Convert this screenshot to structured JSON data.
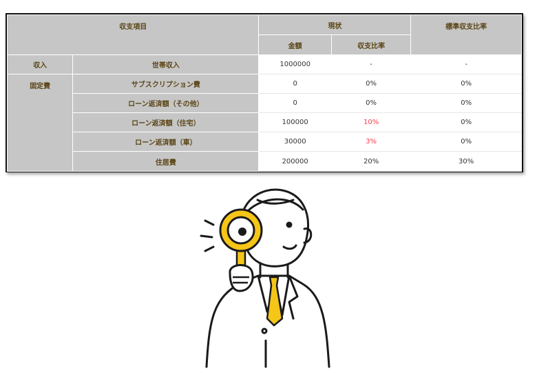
{
  "table": {
    "header": {
      "item": "収支項目",
      "current": "現状",
      "standard": "標準収支比率",
      "amount": "金額",
      "ratio": "収支比率"
    },
    "rows": [
      {
        "category": "収入",
        "label": "世帯収入",
        "amount": "1000000",
        "ratio": "-",
        "standard": "-"
      },
      {
        "category": "固定費",
        "label": "サブスクリプション費",
        "amount": "0",
        "ratio": "0%",
        "standard": "0%"
      },
      {
        "category": "",
        "label": "ローン返済額（その他）",
        "amount": "0",
        "ratio": "0%",
        "standard": "0%"
      },
      {
        "category": "",
        "label": "ローン返済額（住宅）",
        "amount": "100000",
        "ratio": "10%",
        "standard": "0%"
      },
      {
        "category": "",
        "label": "ローン返済額（車）",
        "amount": "30000",
        "ratio": "3%",
        "standard": "0%"
      },
      {
        "category": "",
        "label": "住居費",
        "amount": "200000",
        "ratio": "20%",
        "standard": "30%"
      }
    ],
    "colors": {
      "header_bg": "#c6c6c6",
      "header_text": "#5b4516",
      "highlight": "#ff3b4a"
    }
  },
  "illustration": {
    "icon": "businessman-magnifying-glass-icon",
    "accent": "#f5c518"
  }
}
